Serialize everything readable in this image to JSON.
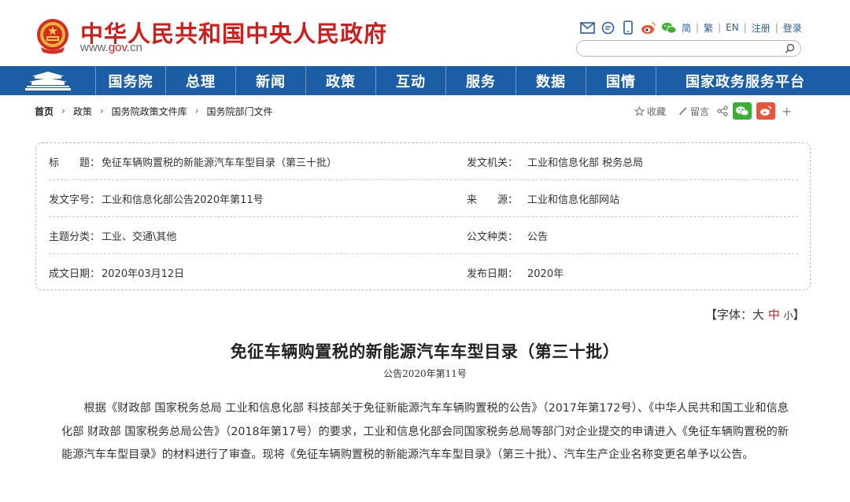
{
  "header": {
    "site_title": "中华人民共和国中央人民政府",
    "site_url_prefix": "www.",
    "site_url_domain": "gov",
    "site_url_suffix": ".cn",
    "icons": [
      "mail-icon",
      "message-icon",
      "mobile-icon",
      "weibo-icon",
      "wechat-icon"
    ],
    "links": [
      "简",
      "繁",
      "EN",
      "注册",
      "登录"
    ],
    "search_placeholder": ""
  },
  "nav": {
    "items": [
      "国务院",
      "总理",
      "新闻",
      "政策",
      "互动",
      "服务",
      "数据",
      "国情",
      "国家政务服务平台"
    ]
  },
  "breadcrumb": {
    "items": [
      "首页",
      "政策",
      "国务院政策文件库",
      "国务院部门文件"
    ]
  },
  "tools": {
    "favorite": "收藏",
    "comment": "留言"
  },
  "info": {
    "rows": [
      {
        "l1": "标　　题：",
        "v1": "免征车辆购置税的新能源汽车车型目录（第三十批）",
        "l2": "发文机关：",
        "v2": "工业和信息化部 税务总局"
      },
      {
        "l1": "发文字号：",
        "v1": "工业和信息化部公告2020年第11号",
        "l2": "来　　源：",
        "v2": "工业和信息化部网站"
      },
      {
        "l1": "主题分类：",
        "v1": "工业、交通\\其他",
        "l2": "公文种类：",
        "v2": "公告"
      },
      {
        "l1": "成文日期：",
        "v1": "2020年03月12日",
        "l2": "发布日期：",
        "v2": "2020年"
      }
    ]
  },
  "article": {
    "font_ctl_open": "【字体：",
    "font_large": "大",
    "font_medium": "中",
    "font_small": "小",
    "font_ctl_close": "】",
    "title": "免征车辆购置税的新能源汽车车型目录（第三十批）",
    "doc_no": "公告2020年第11号",
    "paragraph": "根据《财政部 国家税务总局 工业和信息化部 科技部关于免征新能源汽车车辆购置税的公告》（2017年第172号）、《中华人民共和国工业和信息化部 财政部 国家税务总局公告》（2018年第17号）的要求，工业和信息化部会同国家税务总局等部门对企业提交的申请进入《免征车辆购置税的新能源汽车车型目录》的材料进行了审查。现将《免征车辆购置税的新能源汽车车型目录》（第三十批）、汽车生产企业名称变更名单予以公告。"
  },
  "colors": {
    "brand_red": "#d01e1e",
    "nav_blue": "#1c5ea6",
    "wechat_green": "#3cb034",
    "weibo_orange": "#e8553a"
  }
}
